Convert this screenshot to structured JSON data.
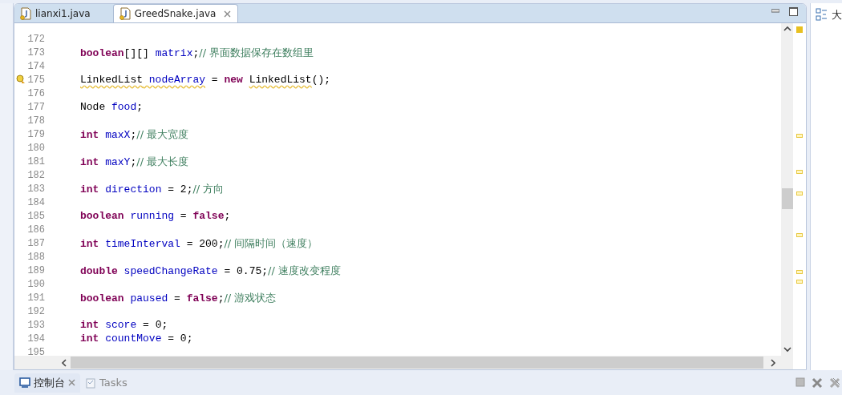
{
  "editor": {
    "tabs": [
      {
        "label": "lianxi1.java",
        "selected": false,
        "closable": false
      },
      {
        "label": "GreedSnake.java",
        "selected": true,
        "closable": true
      }
    ],
    "lines": [
      {
        "number": "172"
      },
      {
        "number": "173",
        "segments": [
          {
            "kind": "keyword",
            "text": "boolean"
          },
          {
            "kind": "plain",
            "text": "[][] "
          },
          {
            "kind": "field",
            "text": "matrix"
          },
          {
            "kind": "plain",
            "text": ";"
          },
          {
            "kind": "comment",
            "text": "// 界面数据保存在数组里"
          }
        ]
      },
      {
        "number": "174"
      },
      {
        "number": "175",
        "has_warning": true,
        "segments": [
          {
            "kind": "plain",
            "text": "LinkedList",
            "warning": true
          },
          {
            "kind": "field",
            "text": " nodeArray",
            "warning": true
          },
          {
            "kind": "plain",
            "text": " = "
          },
          {
            "kind": "keyword",
            "text": "new "
          },
          {
            "kind": "plain",
            "text": "LinkedList",
            "warning": true
          },
          {
            "kind": "plain",
            "text": "();"
          }
        ]
      },
      {
        "number": "176"
      },
      {
        "number": "177",
        "segments": [
          {
            "kind": "plain",
            "text": "Node "
          },
          {
            "kind": "field",
            "text": "food"
          },
          {
            "kind": "plain",
            "text": ";"
          }
        ]
      },
      {
        "number": "178"
      },
      {
        "number": "179",
        "segments": [
          {
            "kind": "keyword",
            "text": "int "
          },
          {
            "kind": "field",
            "text": "maxX"
          },
          {
            "kind": "plain",
            "text": ";"
          },
          {
            "kind": "comment",
            "text": "// 最大宽度"
          }
        ]
      },
      {
        "number": "180"
      },
      {
        "number": "181",
        "segments": [
          {
            "kind": "keyword",
            "text": "int "
          },
          {
            "kind": "field",
            "text": "maxY"
          },
          {
            "kind": "plain",
            "text": ";"
          },
          {
            "kind": "comment",
            "text": "// 最大长度"
          }
        ]
      },
      {
        "number": "182"
      },
      {
        "number": "183",
        "segments": [
          {
            "kind": "keyword",
            "text": "int "
          },
          {
            "kind": "field",
            "text": "direction"
          },
          {
            "kind": "plain",
            "text": " = 2;"
          },
          {
            "kind": "comment",
            "text": "// 方向"
          }
        ]
      },
      {
        "number": "184"
      },
      {
        "number": "185",
        "segments": [
          {
            "kind": "keyword",
            "text": "boolean "
          },
          {
            "kind": "field",
            "text": "running"
          },
          {
            "kind": "plain",
            "text": " = "
          },
          {
            "kind": "keyword",
            "text": "false"
          },
          {
            "kind": "plain",
            "text": ";"
          }
        ]
      },
      {
        "number": "186"
      },
      {
        "number": "187",
        "segments": [
          {
            "kind": "keyword",
            "text": "int "
          },
          {
            "kind": "field",
            "text": "timeInterval"
          },
          {
            "kind": "plain",
            "text": " = 200;"
          },
          {
            "kind": "comment",
            "text": "// 间隔时间（速度）"
          }
        ]
      },
      {
        "number": "188"
      },
      {
        "number": "189",
        "segments": [
          {
            "kind": "keyword",
            "text": "double "
          },
          {
            "kind": "field",
            "text": "speedChangeRate"
          },
          {
            "kind": "plain",
            "text": " = 0.75;"
          },
          {
            "kind": "comment",
            "text": "// 速度改变程度"
          }
        ]
      },
      {
        "number": "190"
      },
      {
        "number": "191",
        "segments": [
          {
            "kind": "keyword",
            "text": "boolean "
          },
          {
            "kind": "field",
            "text": "paused"
          },
          {
            "kind": "plain",
            "text": " = "
          },
          {
            "kind": "keyword",
            "text": "false"
          },
          {
            "kind": "plain",
            "text": ";"
          },
          {
            "kind": "comment",
            "text": "// 游戏状态"
          }
        ]
      },
      {
        "number": "192"
      },
      {
        "number": "193",
        "segments": [
          {
            "kind": "keyword",
            "text": "int "
          },
          {
            "kind": "field",
            "text": "score"
          },
          {
            "kind": "plain",
            "text": " = 0;"
          }
        ]
      },
      {
        "number": "194",
        "segments": [
          {
            "kind": "keyword",
            "text": "int "
          },
          {
            "kind": "field",
            "text": "countMove"
          },
          {
            "kind": "plain",
            "text": " = 0;"
          }
        ]
      },
      {
        "number": "195"
      }
    ]
  },
  "outline": {
    "tab_label": "大"
  },
  "bottom_panel": {
    "tabs": [
      {
        "label": "控制台",
        "selected": true,
        "closable": true
      },
      {
        "label": "Tasks",
        "selected": false,
        "closable": false
      }
    ]
  }
}
